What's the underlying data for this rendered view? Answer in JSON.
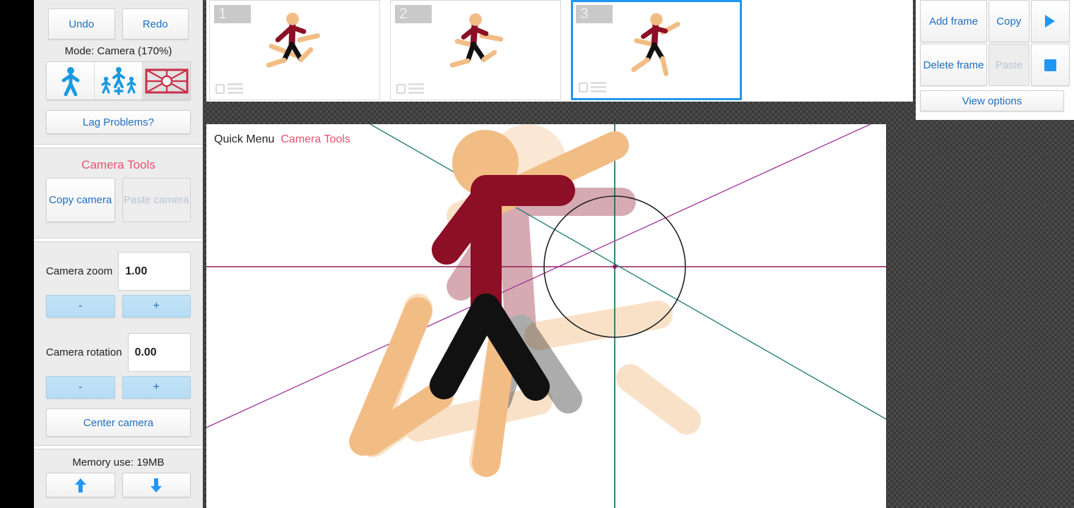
{
  "app": {
    "accent_red": "#e8526e",
    "accent_blue": "#1f6fbf",
    "icon_blue": "#2196f3"
  },
  "sidebar": {
    "undo_label": "Undo",
    "redo_label": "Redo",
    "mode_label": "Mode: Camera (170%)",
    "mode_buttons": [
      {
        "name": "single-stickfigure-icon",
        "label": "Single figure mode",
        "active": false
      },
      {
        "name": "multi-stickfigure-icon",
        "label": "Multi figure mode",
        "active": false
      },
      {
        "name": "camera-frame-icon",
        "label": "Camera mode",
        "active": true
      }
    ],
    "lag_label": "Lag Problems?",
    "camera_tools_title": "Camera Tools",
    "copy_camera_label": "Copy camera",
    "paste_camera_label": "Paste camera",
    "paste_camera_disabled": true,
    "zoom_label": "Camera zoom",
    "zoom_value": "1.00",
    "zoom_minus": "-",
    "zoom_plus": "+",
    "rotation_label": "Camera rotation",
    "rotation_value": "0.00",
    "rotation_minus": "-",
    "rotation_plus": "+",
    "center_camera_label": "Center camera",
    "memory_label": "Memory use: 19MB",
    "memory_up": "⬆",
    "memory_down": "⬇"
  },
  "frames": [
    {
      "number": "1",
      "selected": false
    },
    {
      "number": "2",
      "selected": false
    },
    {
      "number": "3",
      "selected": true
    }
  ],
  "canvas": {
    "quick_menu_label": "Quick Menu",
    "camera_tools_label": "Camera Tools",
    "guide_horizontal_color": "#8e2060",
    "guide_vertical_color": "#116655",
    "guide_diag_teal_color": "#1a7a6e",
    "guide_diag_purple_color": "#a0309a",
    "camera_circle_color": "#222222",
    "figure_skin_color": "#f2bd85",
    "figure_torso_color": "#8c0f26",
    "figure_legs_color": "#111111",
    "onion_skin_color": "#f6dcc2"
  },
  "right_panel": {
    "add_frame_label": "Add frame",
    "copy_label": "Copy",
    "play_label": "▶",
    "delete_frame_label": "Delete frame",
    "paste_label": "Paste",
    "paste_disabled": true,
    "stop_label": "■",
    "view_options_label": "View options"
  }
}
